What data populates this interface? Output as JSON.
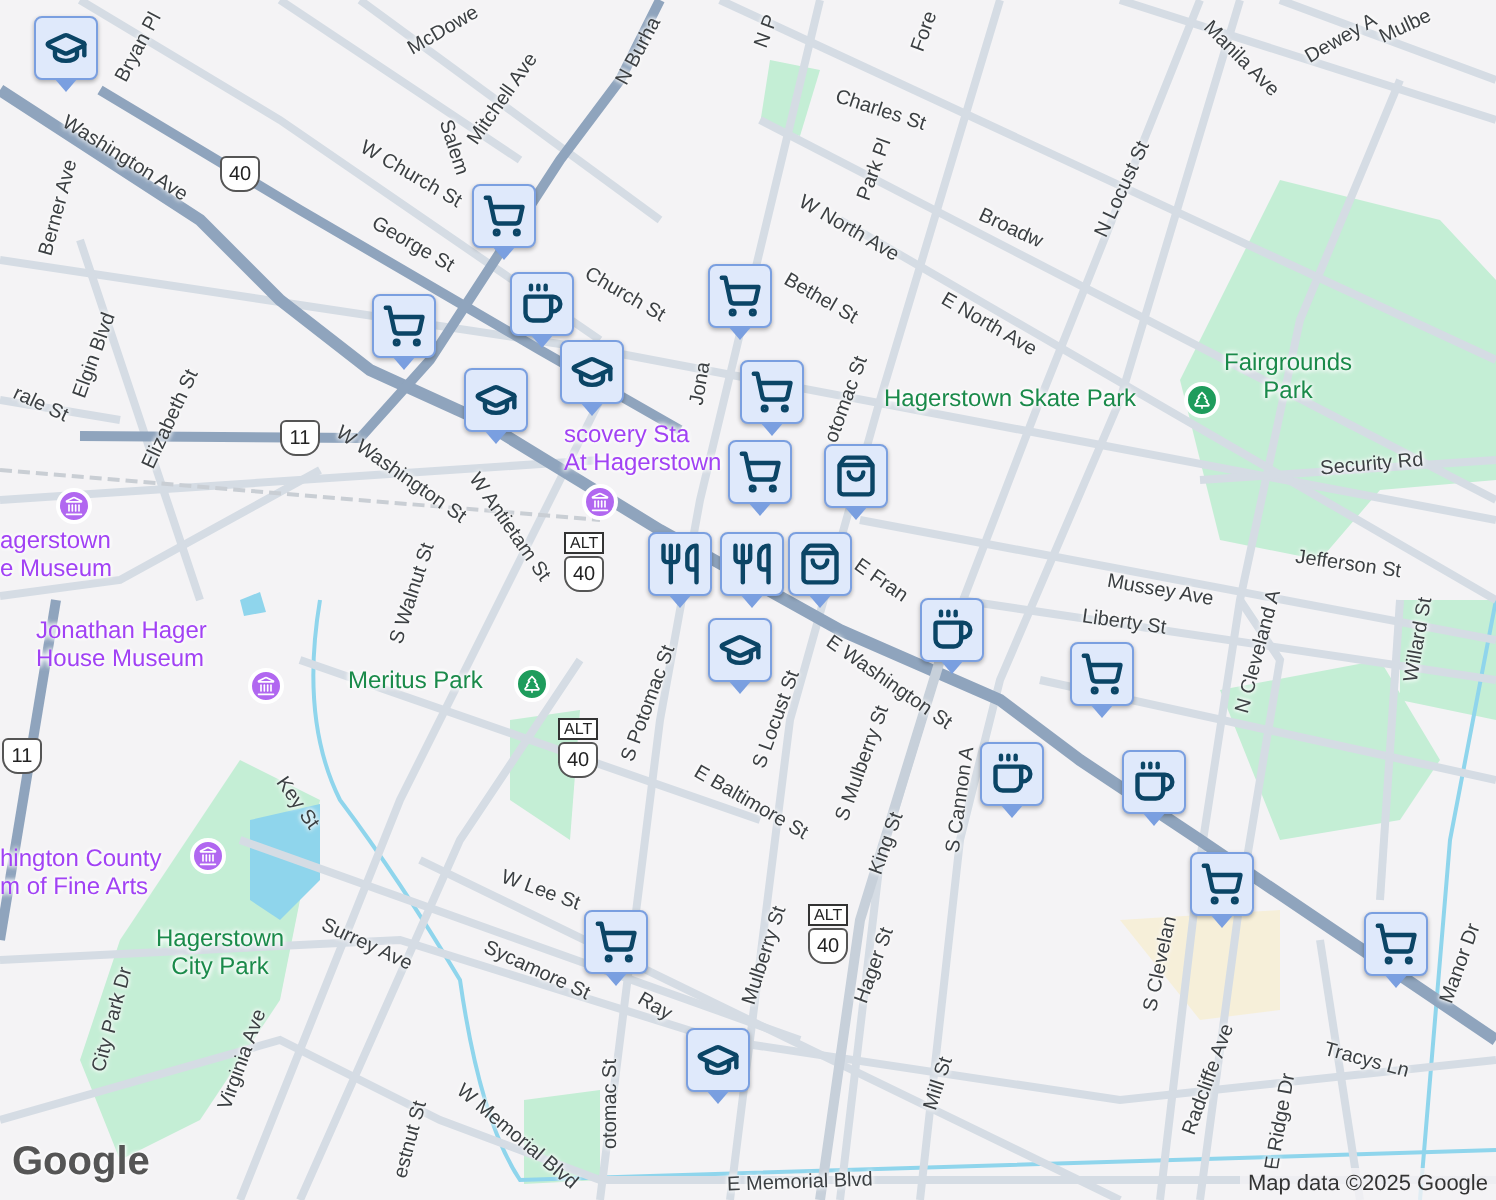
{
  "map": {
    "streets": [
      "Bryan Pl",
      "McDowe",
      "Mitchell Ave",
      "N Burha",
      "Washington Ave",
      "W Church St",
      "Salem",
      "George St",
      "Berner Ave",
      "Church St",
      "Elgin Blvd",
      "Elizabeth St",
      "rale St",
      "W Washington St",
      "W Antietam St",
      "S Walnut St",
      "Jona",
      "N P",
      "Fore",
      "Charles St",
      "Park Pl",
      "W North Ave",
      "Bethel St",
      "Broadw",
      "N Locust St",
      "E North Ave",
      "otomac St",
      "Manila Ave",
      "Dewey A",
      "Mulbe",
      "Security Rd",
      "Jefferson St",
      "Mussey Ave",
      "Liberty St",
      "N Cleveland A",
      "Willard St",
      "E Fran",
      "E Washington St",
      "S Potomac St",
      "S Locust St",
      "S Mulberry St",
      "King St",
      "S Cannon A",
      "E Baltimore St",
      "W Lee St",
      "Sycamore St",
      "Key St",
      "Surrey Ave",
      "City Park Dr",
      "Virginia Ave",
      "Hager St",
      "Mill St",
      "S Clevelan",
      "Radcliffe Ave",
      "E Ridge Dr",
      "Tracys Ln",
      "Manor Dr",
      "Mulberry St",
      "Ray",
      "W Memorial Blvd",
      "E Memorial Blvd",
      "otomac St",
      "estnut St"
    ],
    "places": [
      {
        "label": "scovery Sta\nAt Hagerstown",
        "kind": "museum"
      },
      {
        "label": "agerstown\ne Museum",
        "kind": "museum"
      },
      {
        "label": "Jonathan Hager\nHouse Museum",
        "kind": "museum"
      },
      {
        "label": "hington County\nm of Fine Arts",
        "kind": "museum"
      },
      {
        "label": "Meritus Park",
        "kind": "park"
      },
      {
        "label": "Hagerstown\nCity Park",
        "kind": "area"
      },
      {
        "label": "Hagerstown Skate Park",
        "kind": "park"
      },
      {
        "label": "Fairgrounds\nPark",
        "kind": "area"
      }
    ],
    "shields": [
      {
        "kind": "us",
        "number": "40"
      },
      {
        "kind": "us",
        "number": "11"
      },
      {
        "kind": "alt",
        "label": "ALT",
        "number": "40"
      },
      {
        "kind": "alt",
        "label": "ALT",
        "number": "40"
      },
      {
        "kind": "alt",
        "label": "ALT",
        "number": "40"
      },
      {
        "kind": "us",
        "number": "11"
      }
    ],
    "markers": [
      {
        "kind": "school"
      },
      {
        "kind": "cart"
      },
      {
        "kind": "cart"
      },
      {
        "kind": "cup"
      },
      {
        "kind": "school"
      },
      {
        "kind": "school"
      },
      {
        "kind": "cart"
      },
      {
        "kind": "cart"
      },
      {
        "kind": "cart"
      },
      {
        "kind": "bag"
      },
      {
        "kind": "fork"
      },
      {
        "kind": "fork"
      },
      {
        "kind": "bag"
      },
      {
        "kind": "school"
      },
      {
        "kind": "cup"
      },
      {
        "kind": "cart"
      },
      {
        "kind": "cup"
      },
      {
        "kind": "cup"
      },
      {
        "kind": "cart"
      },
      {
        "kind": "cart"
      },
      {
        "kind": "cart"
      },
      {
        "kind": "school"
      }
    ],
    "logo": "Google",
    "attribution": "Map data ©2025 Google"
  }
}
